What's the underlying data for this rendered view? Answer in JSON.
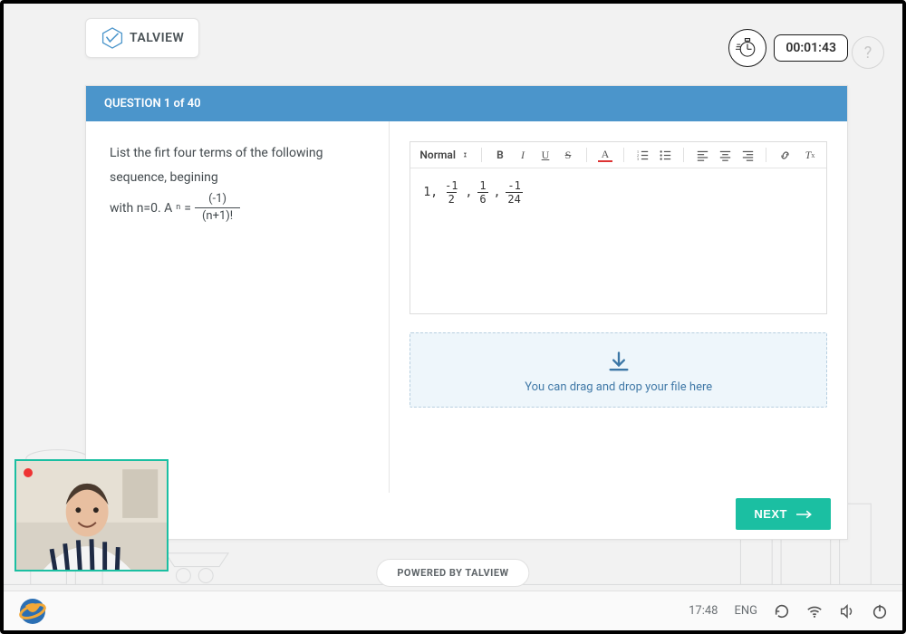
{
  "brand": {
    "name": "TALVIEW"
  },
  "timer": {
    "value": "00:01:43"
  },
  "question": {
    "header": "QUESTION 1 of 40",
    "prompt_prefix": "List the firt four terms of the following sequence, begining",
    "prompt_line2_prefix": "with n=0. A",
    "prompt_sub": "n",
    "prompt_eq": " = ",
    "numerator": "(-1)",
    "denominator": "(n+1)!"
  },
  "editor": {
    "format_label": "Normal",
    "answer": {
      "lead": "1,",
      "t1_num": "-1",
      "t1_den": "2",
      "t2_num": "1",
      "t2_den": "6",
      "t3_num": "-1",
      "t3_den": "24"
    }
  },
  "dropzone": {
    "text": "You can drag and drop your file here"
  },
  "buttons": {
    "next": "NEXT"
  },
  "footer": {
    "powered": "POWERED BY TALVIEW"
  },
  "taskbar": {
    "time": "17:48",
    "lang": "ENG"
  }
}
